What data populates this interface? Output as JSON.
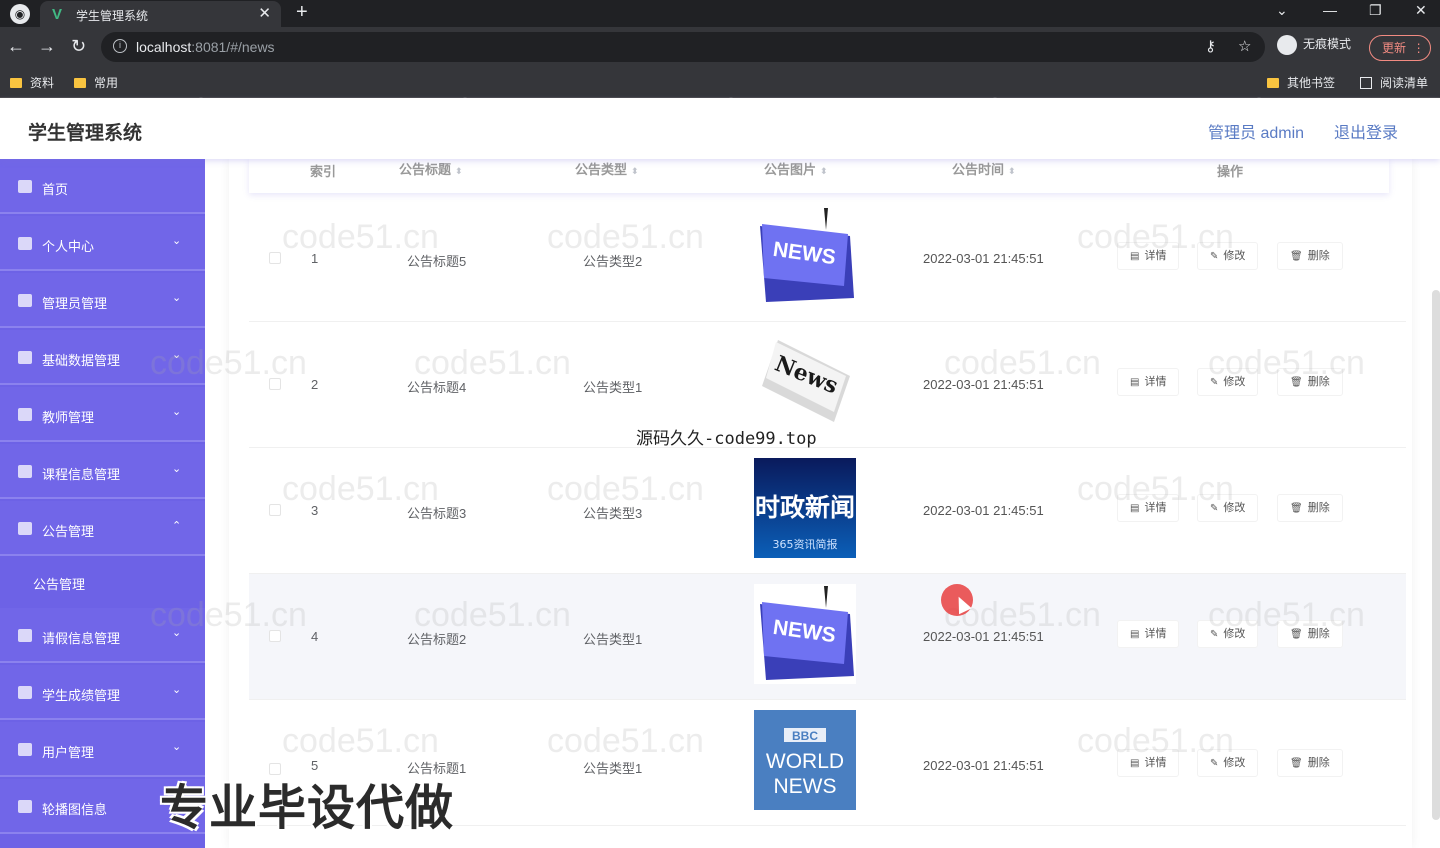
{
  "browser": {
    "tab_title": "学生管理系统",
    "url_host": "localhost",
    "url_rest": ":8081/#/news",
    "incognito_label": "无痕模式",
    "update_label": "更新",
    "bookmarks": [
      "资料",
      "常用"
    ],
    "bookmarks_right": [
      "其他书签",
      "阅读清单"
    ]
  },
  "header": {
    "title": "学生管理系统",
    "user": "管理员 admin",
    "logout": "退出登录"
  },
  "sidebar": {
    "items": [
      {
        "label": "首页",
        "arrow": ""
      },
      {
        "label": "个人中心",
        "arrow": "⌄"
      },
      {
        "label": "管理员管理",
        "arrow": "⌄"
      },
      {
        "label": "基础数据管理",
        "arrow": "⌄"
      },
      {
        "label": "教师管理",
        "arrow": "⌄"
      },
      {
        "label": "课程信息管理",
        "arrow": "⌄"
      },
      {
        "label": "公告管理",
        "arrow": "⌃"
      },
      {
        "label": "请假信息管理",
        "arrow": "⌄"
      },
      {
        "label": "学生成绩管理",
        "arrow": "⌄"
      },
      {
        "label": "用户管理",
        "arrow": "⌄"
      },
      {
        "label": "轮播图信息",
        "arrow": ""
      }
    ],
    "subitem": "公告管理"
  },
  "table": {
    "headers": [
      "索引",
      "公告标题",
      "公告类型",
      "公告图片",
      "公告时间",
      "操作"
    ],
    "rows": [
      {
        "index": "1",
        "title": "公告标题5",
        "type": "公告类型2",
        "time": "2022-03-01 21:45:51",
        "image": "news-keyboard"
      },
      {
        "index": "2",
        "title": "公告标题4",
        "type": "公告类型1",
        "time": "2022-03-01 21:45:51",
        "image": "news-paper"
      },
      {
        "index": "3",
        "title": "公告标题3",
        "type": "公告类型3",
        "time": "2022-03-01 21:45:51",
        "image": "shizheng-news"
      },
      {
        "index": "4",
        "title": "公告标题2",
        "type": "公告类型1",
        "time": "2022-03-01 21:45:51",
        "image": "news-keyboard"
      },
      {
        "index": "5",
        "title": "公告标题1",
        "type": "公告类型1",
        "time": "2022-03-01 21:45:51",
        "image": "bbc-world-news"
      }
    ],
    "actions": {
      "detail": "详情",
      "edit": "修改",
      "delete": "删除"
    },
    "img_text": {
      "news": "NEWS",
      "news2": "News",
      "sz1": "时政新闻",
      "sz2": "365资讯简报",
      "bbc1": "BBC",
      "bbc2": "WORLD",
      "bbc3": "NEWS"
    }
  },
  "overlays": {
    "center_watermark": "源码久久-code99.top",
    "promo": "专业毕设代做",
    "tile_watermark": "code51.cn"
  },
  "colors": {
    "sidebar": "#6d62e6",
    "accent": "#5a7bc4"
  }
}
